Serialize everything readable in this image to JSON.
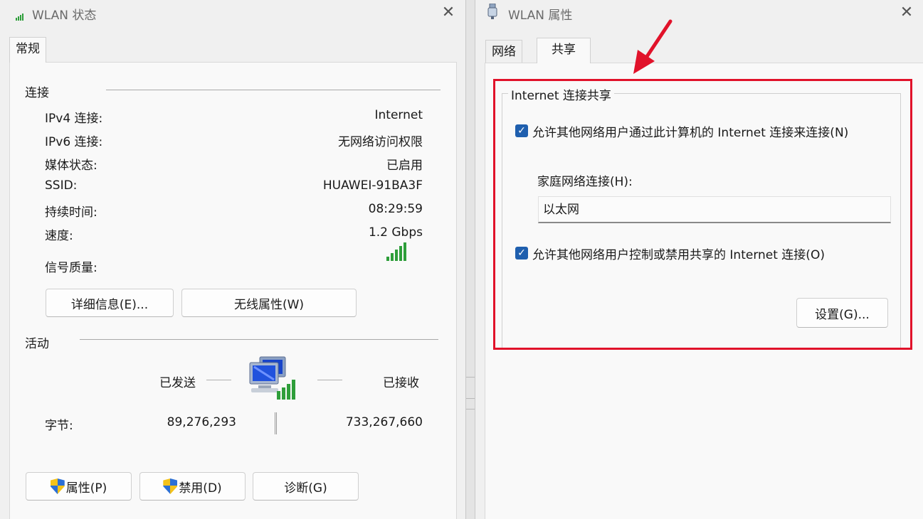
{
  "left_window": {
    "title": "WLAN 状态",
    "close_glyph": "✕",
    "tab": "常规",
    "connection": {
      "group_label": "连接",
      "rows": [
        {
          "label": "IPv4 连接:",
          "value": "Internet"
        },
        {
          "label": "IPv6 连接:",
          "value": "无网络访问权限"
        },
        {
          "label": "媒体状态:",
          "value": "已启用"
        },
        {
          "label": "SSID:",
          "value": "HUAWEI-91BA3F"
        },
        {
          "label": "持续时间:",
          "value": "08:29:59"
        },
        {
          "label": "速度:",
          "value": "1.2 Gbps"
        }
      ],
      "signal_label": "信号质量:",
      "signal_bars": 5,
      "signal_bars_total": 5,
      "details_button": "详细信息(E)...",
      "wireless_button": "无线属性(W)"
    },
    "activity": {
      "group_label": "活动",
      "sent_label": "已发送",
      "received_label": "已接收",
      "bytes_label": "字节:",
      "bytes_sent": "89,276,293",
      "bytes_received": "733,267,660"
    },
    "buttons": {
      "properties": "属性(P)",
      "disable": "禁用(D)",
      "diagnose": "诊断(G)"
    }
  },
  "right_window": {
    "title": "WLAN 属性",
    "close_glyph": "✕",
    "tabs": [
      {
        "label": "网络",
        "active": false
      },
      {
        "label": "共享",
        "active": true
      }
    ],
    "ics": {
      "group_label": "Internet 连接共享",
      "allow_connect_label": "允许其他网络用户通过此计算机的 Internet 连接来连接(N)",
      "allow_connect_checked": true,
      "home_network_label": "家庭网络连接(H):",
      "home_network_value": "以太网",
      "allow_control_label": "允许其他网络用户控制或禁用共享的 Internet 连接(O)",
      "allow_control_checked": true,
      "settings_button": "设置(G)..."
    }
  },
  "colors": {
    "annotation_red": "#e1122a",
    "checkbox_blue": "#1f5fae",
    "signal_green": "#2e9e3a",
    "shield_blue": "#2b6fd6",
    "shield_yellow": "#f4c21a"
  },
  "icons": {
    "left_title_icon": "wifi-signal-icon",
    "right_title_icon": "network-adapter-icon",
    "activity_icon": "network-computers-icon",
    "button_icon": "uac-shield-icon",
    "annotation": "red-arrow-icon"
  }
}
